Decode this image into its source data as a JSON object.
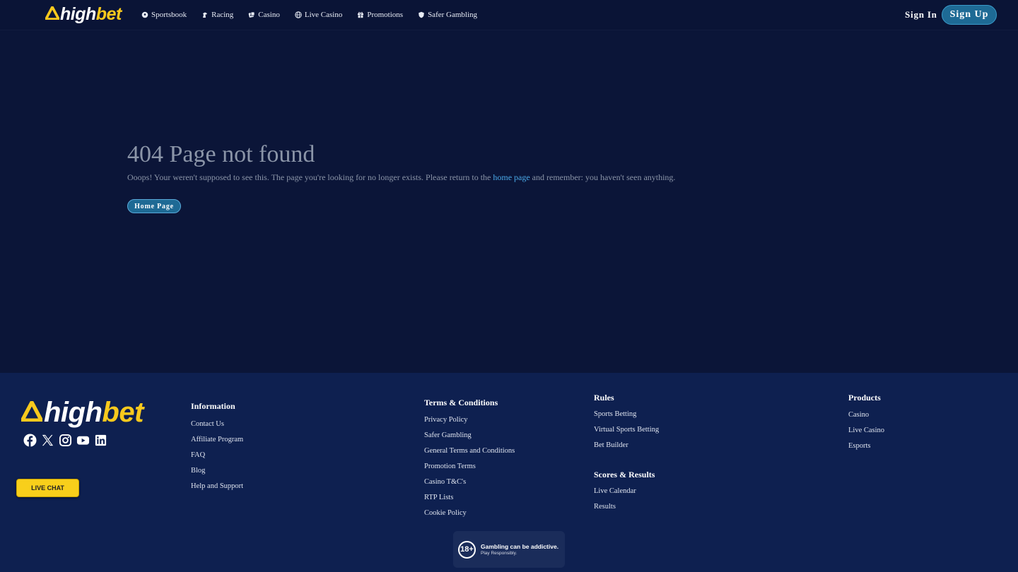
{
  "brand": {
    "high": "high",
    "bet": "bet",
    "accent": "#f8c91d"
  },
  "nav": [
    {
      "label": "Sportsbook",
      "icon": "soccer-ball-icon"
    },
    {
      "label": "Racing",
      "icon": "horse-icon"
    },
    {
      "label": "Casino",
      "icon": "dice-icon"
    },
    {
      "label": "Live Casino",
      "icon": "globe-icon"
    },
    {
      "label": "Promotions",
      "icon": "gift-icon"
    },
    {
      "label": "Safer Gambling",
      "icon": "shield-icon"
    }
  ],
  "auth": {
    "signin": "Sign In",
    "signup": "Sign Up"
  },
  "error": {
    "title": "404 Page not found",
    "msg_before": "Ooops! Your weren't supposed to see this. The page you're looking for no longer exists. Please return to the ",
    "msg_link": "home page",
    "msg_after": " and remember: you haven't seen anything.",
    "button": "Home Page"
  },
  "footer": {
    "socials": [
      "facebook-icon",
      "x-icon",
      "instagram-icon",
      "youtube-icon",
      "linkedin-icon"
    ],
    "live_chat": "LIVE CHAT",
    "information": {
      "title": "Information",
      "links": [
        "Contact Us",
        "Affiliate Program",
        "FAQ",
        "Blog",
        "Help and Support"
      ]
    },
    "terms": {
      "title": "Terms & Conditions",
      "links": [
        "Privacy Policy",
        "Safer Gambling",
        "General Terms and Conditions",
        "Promotion Terms",
        "Casino T&C's",
        "RTP Lists",
        "Cookie Policy"
      ]
    },
    "rules": {
      "title": "Rules",
      "links": [
        "Sports Betting",
        "Virtual Sports Betting",
        "Bet Builder"
      ]
    },
    "scores": {
      "title": "Scores & Results",
      "links": [
        "Live Calendar",
        "Results"
      ]
    },
    "products": {
      "title": "Products",
      "links": [
        "Casino",
        "Live Casino",
        "Esports"
      ]
    },
    "badge": {
      "age": "18+",
      "line1": "Gambling can be addictive.",
      "line2": "Play Responsibly."
    }
  }
}
